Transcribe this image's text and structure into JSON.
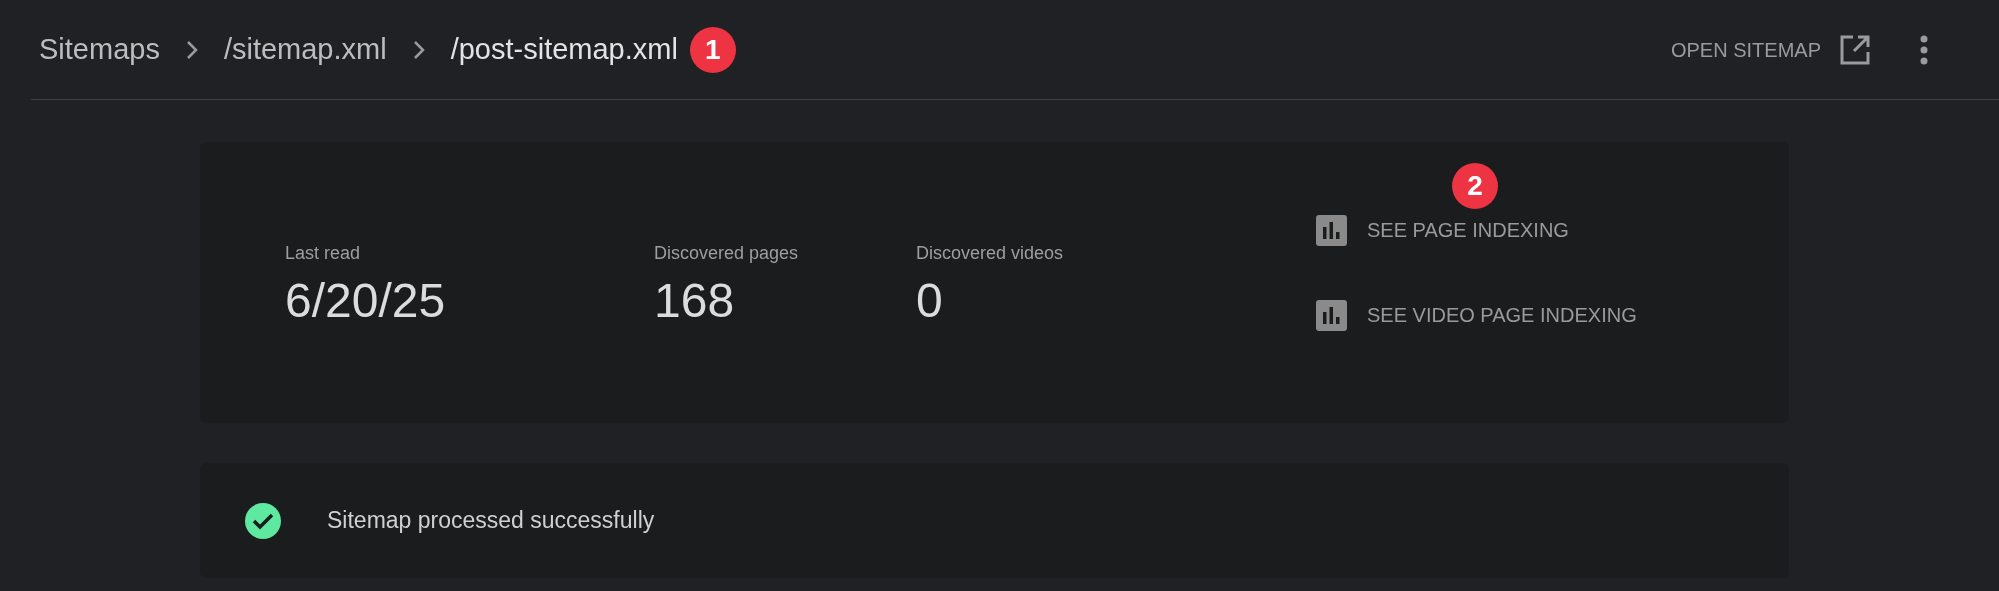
{
  "breadcrumb": [
    {
      "label": "Sitemaps",
      "current": false
    },
    {
      "label": "/sitemap.xml",
      "current": false
    },
    {
      "label": "/post-sitemap.xml",
      "current": true,
      "badge": "1"
    }
  ],
  "header_actions": {
    "open_label": "OPEN SITEMAP"
  },
  "stats": [
    {
      "label": "Last read",
      "value": "6/20/25"
    },
    {
      "label": "Discovered pages",
      "value": "168"
    },
    {
      "label": "Discovered videos",
      "value": "0"
    }
  ],
  "links": [
    {
      "label": "SEE PAGE INDEXING",
      "badge": "2"
    },
    {
      "label": "SEE VIDEO PAGE INDEXING"
    }
  ],
  "status": {
    "kind": "success",
    "text": "Sitemap processed successfully"
  }
}
